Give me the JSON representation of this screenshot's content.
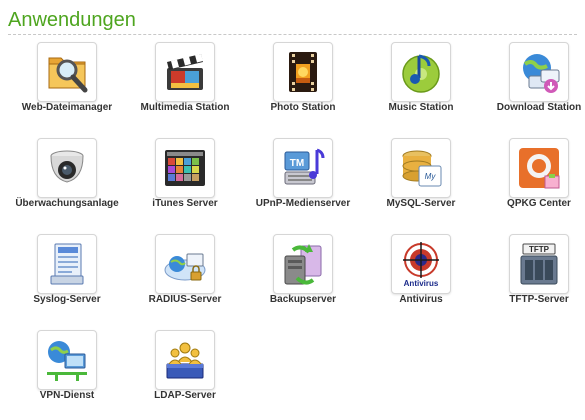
{
  "header": {
    "title": "Anwendungen"
  },
  "apps": [
    {
      "label": "Web-Dateimanager",
      "icon": "web-file-manager-icon"
    },
    {
      "label": "Multimedia Station",
      "icon": "multimedia-station-icon"
    },
    {
      "label": "Photo Station",
      "icon": "photo-station-icon"
    },
    {
      "label": "Music Station",
      "icon": "music-station-icon"
    },
    {
      "label": "Download Station",
      "icon": "download-station-icon"
    },
    {
      "label": "Überwachungsanlage",
      "icon": "surveillance-camera-icon"
    },
    {
      "label": "iTunes Server",
      "icon": "itunes-server-icon"
    },
    {
      "label": "UPnP-Medienserver",
      "icon": "upnp-media-server-icon"
    },
    {
      "label": "MySQL-Server",
      "icon": "mysql-server-icon"
    },
    {
      "label": "QPKG Center",
      "icon": "qpkg-center-icon"
    },
    {
      "label": "Syslog-Server",
      "icon": "syslog-server-icon"
    },
    {
      "label": "RADIUS-Server",
      "icon": "radius-server-icon"
    },
    {
      "label": "Backupserver",
      "icon": "backup-server-icon"
    },
    {
      "label": "Antivirus",
      "icon": "antivirus-icon",
      "icon_text": "Antivirus"
    },
    {
      "label": "TFTP-Server",
      "icon": "tftp-server-icon",
      "icon_text": "TFTP"
    },
    {
      "label": "VPN-Dienst",
      "icon": "vpn-service-icon"
    },
    {
      "label": "LDAP-Server",
      "icon": "ldap-server-icon"
    }
  ],
  "colors": {
    "header": "#4ea51f",
    "label": "#333333",
    "rule": "#c8c8c8"
  }
}
